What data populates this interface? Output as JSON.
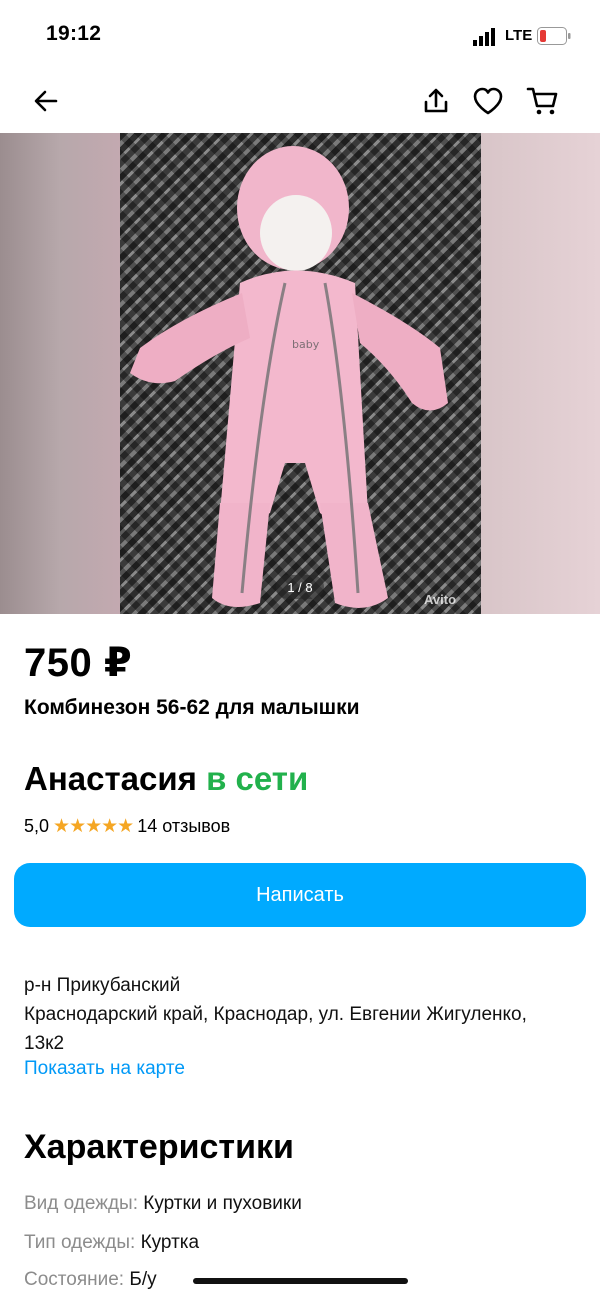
{
  "status": {
    "time": "19:12",
    "network": "LTE"
  },
  "nav": {
    "back_icon": "arrow-left-icon",
    "share_icon": "share-icon",
    "favorite_icon": "heart-icon",
    "cart_icon": "cart-icon"
  },
  "photo": {
    "counter": "1 / 8",
    "watermark": "Avito"
  },
  "listing": {
    "price": "750 ₽",
    "title": "Комбинезон 56-62 для малышки"
  },
  "seller": {
    "name": "Анастасия",
    "online": "в сети",
    "rating": "5,0",
    "stars": 5,
    "reviews": "14 отзывов"
  },
  "actions": {
    "write_label": "Написать"
  },
  "address": {
    "district": "р-н Прикубанский",
    "full": "Краснодарский край, Краснодар, ул. Евгении Жигуленко, 13к2",
    "map_link": "Показать на карте"
  },
  "characteristics": {
    "title": "Характеристики",
    "rows": [
      {
        "key": "Вид одежды:",
        "value": "Куртки и пуховики"
      },
      {
        "key": "Тип одежды:",
        "value": "Куртка"
      },
      {
        "key": "Состояние:",
        "value": "Б/у"
      }
    ]
  },
  "colors": {
    "accent": "#00aaff",
    "online": "#22b14c",
    "link": "#0099f7",
    "star": "#f5a623"
  }
}
